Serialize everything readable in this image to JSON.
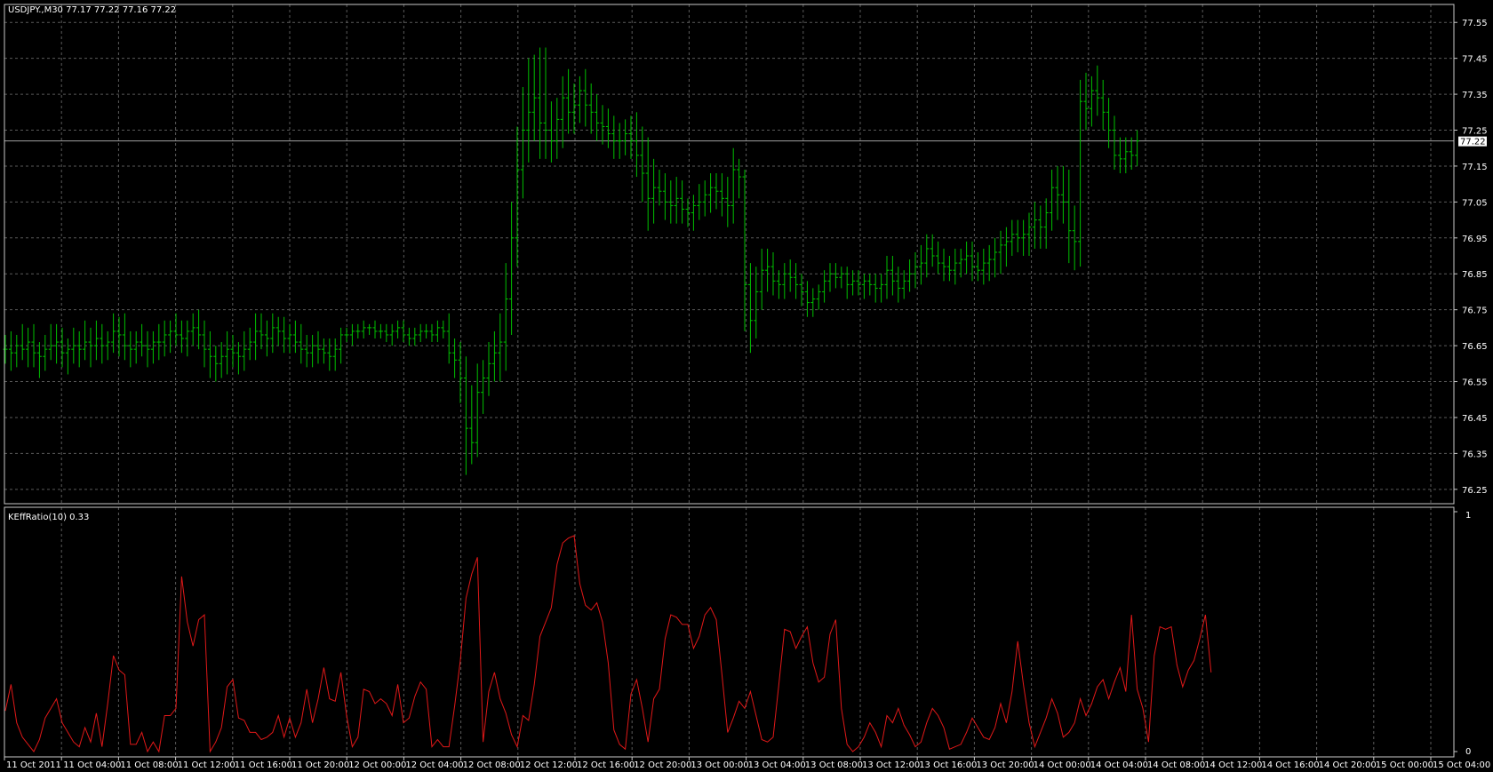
{
  "colors": {
    "background": "#000000",
    "grid": "#5a5a5a",
    "frame": "#c8c8c8",
    "candles": "#00c000",
    "indicator": "#e01818",
    "axis_text": "#ffffff",
    "price_line": "#a0a0a0"
  },
  "price_panel": {
    "title": "USDJPY.,M30  77.17 77.22 77.16 77.22",
    "current_price": "77.22"
  },
  "indicator_panel": {
    "title": "KEffRatio(10) 0.33",
    "top_label": "1",
    "bottom_label": "0"
  },
  "chart_data": [
    {
      "type": "ohlc",
      "title": "USDJPY.,M30  77.17 77.22 77.16 77.22",
      "ylim": [
        76.21,
        77.6
      ],
      "y_ticks": [
        "77.55",
        "77.45",
        "77.35",
        "77.25",
        "77.15",
        "77.05",
        "76.95",
        "76.85",
        "76.75",
        "76.65",
        "76.55",
        "76.45",
        "76.35",
        "76.25"
      ],
      "x_ticks": [
        "11 Oct 2011",
        "11 Oct 04:00",
        "11 Oct 08:00",
        "11 Oct 12:00",
        "11 Oct 16:00",
        "11 Oct 20:00",
        "12 Oct 00:00",
        "12 Oct 04:00",
        "12 Oct 08:00",
        "12 Oct 12:00",
        "12 Oct 16:00",
        "12 Oct 20:00",
        "13 Oct 00:00",
        "13 Oct 04:00",
        "13 Oct 08:00",
        "13 Oct 12:00",
        "13 Oct 16:00",
        "13 Oct 20:00",
        "14 Oct 00:00",
        "14 Oct 04:00",
        "14 Oct 08:00",
        "14 Oct 12:00",
        "14 Oct 16:00",
        "14 Oct 20:00",
        "15 Oct 00:00",
        "15 Oct 04:00"
      ],
      "current_price": 77.22,
      "close": [
        76.64,
        76.63,
        76.65,
        76.64,
        76.66,
        76.63,
        76.62,
        76.64,
        76.65,
        76.66,
        76.63,
        76.64,
        76.65,
        76.64,
        76.66,
        76.65,
        76.67,
        76.65,
        76.66,
        76.69,
        76.68,
        76.65,
        76.64,
        76.66,
        76.65,
        76.64,
        76.66,
        76.66,
        76.68,
        76.69,
        76.68,
        76.67,
        76.69,
        76.7,
        76.68,
        76.64,
        76.62,
        76.6,
        76.62,
        76.64,
        76.63,
        76.62,
        76.64,
        76.66,
        76.69,
        76.68,
        76.67,
        76.7,
        76.69,
        76.67,
        76.68,
        76.66,
        76.64,
        76.63,
        76.65,
        76.64,
        76.63,
        76.62,
        76.64,
        76.68,
        76.68,
        76.69,
        76.69,
        76.7,
        76.7,
        76.69,
        76.69,
        76.68,
        76.69,
        76.7,
        76.68,
        76.67,
        76.68,
        76.69,
        76.69,
        76.68,
        76.7,
        76.69,
        76.63,
        76.61,
        76.56,
        76.42,
        76.38,
        76.52,
        76.56,
        76.6,
        76.63,
        76.66,
        76.78,
        76.95,
        77.14,
        77.25,
        77.3,
        77.34,
        77.27,
        77.25,
        77.22,
        77.28,
        77.34,
        77.3,
        77.32,
        77.36,
        77.32,
        77.3,
        77.27,
        77.26,
        77.24,
        77.22,
        77.22,
        77.24,
        77.22,
        77.18,
        77.13,
        77.06,
        77.09,
        77.08,
        77.05,
        77.04,
        77.06,
        77.03,
        77.02,
        77.04,
        77.05,
        77.07,
        77.09,
        77.08,
        77.06,
        77.04,
        77.14,
        77.12,
        76.82,
        76.72,
        76.8,
        76.86,
        76.87,
        76.83,
        76.82,
        76.85,
        76.84,
        76.82,
        76.8,
        76.77,
        76.78,
        76.8,
        76.83,
        76.85,
        76.84,
        76.85,
        76.82,
        76.83,
        76.82,
        76.83,
        76.82,
        76.81,
        76.82,
        76.86,
        76.83,
        76.81,
        76.83,
        76.85,
        76.87,
        76.88,
        76.92,
        76.9,
        76.88,
        76.87,
        76.86,
        76.88,
        76.89,
        76.9,
        76.87,
        76.86,
        76.88,
        76.89,
        76.91,
        76.93,
        76.94,
        76.96,
        76.95,
        76.96,
        76.98,
        77.0,
        76.98,
        77.02,
        77.09,
        77.07,
        77.05,
        76.97,
        76.94,
        77.33,
        77.31,
        77.36,
        77.34,
        77.3,
        77.25,
        77.18,
        77.17,
        77.19,
        77.18,
        77.22
      ],
      "high_offset": [
        0.04,
        0.05,
        0.03,
        0.06,
        0.04,
        0.05,
        0.03,
        0.04,
        0.06,
        0.05,
        0.04,
        0.03,
        0.05,
        0.04,
        0.06,
        0.04,
        0.05,
        0.04,
        0.03,
        0.05,
        0.04,
        0.06,
        0.04,
        0.03,
        0.05,
        0.04,
        0.03,
        0.05,
        0.04,
        0.03,
        0.05,
        0.04,
        0.03,
        0.04,
        0.05,
        0.04,
        0.05,
        0.03,
        0.04,
        0.05,
        0.04,
        0.03,
        0.05,
        0.04,
        0.05,
        0.05,
        0.04,
        0.04,
        0.03,
        0.04,
        0.03,
        0.04,
        0.05,
        0.04,
        0.03,
        0.04,
        0.03,
        0.04,
        0.03,
        0.02,
        0.02,
        0.02,
        0.02,
        0.02,
        0.01,
        0.02,
        0.02,
        0.02,
        0.02,
        0.02,
        0.02,
        0.02,
        0.02,
        0.02,
        0.02,
        0.02,
        0.02,
        0.02,
        0.05,
        0.04,
        0.05,
        0.06,
        0.12,
        0.08,
        0.05,
        0.06,
        0.06,
        0.08,
        0.1,
        0.1,
        0.12,
        0.12,
        0.15,
        0.12,
        0.14,
        0.21,
        0.08,
        0.06,
        0.06,
        0.08,
        0.06,
        0.04,
        0.06,
        0.06,
        0.05,
        0.05,
        0.05,
        0.05,
        0.05,
        0.04,
        0.05,
        0.08,
        0.08,
        0.1,
        0.08,
        0.05,
        0.05,
        0.06,
        0.06,
        0.05,
        0.03,
        0.03,
        0.05,
        0.04,
        0.04,
        0.04,
        0.05,
        0.06,
        0.06,
        0.03,
        0.02,
        0.06,
        0.07,
        0.06,
        0.05,
        0.04,
        0.03,
        0.03,
        0.04,
        0.04,
        0.03,
        0.03,
        0.03,
        0.02,
        0.03,
        0.03,
        0.03,
        0.02,
        0.02,
        0.03,
        0.03,
        0.02,
        0.02,
        0.03,
        0.03,
        0.04,
        0.04,
        0.04,
        0.03,
        0.04,
        0.04,
        0.05,
        0.04,
        0.04,
        0.04,
        0.04,
        0.03,
        0.04,
        0.03,
        0.04,
        0.04,
        0.04,
        0.04,
        0.04,
        0.04,
        0.04,
        0.04,
        0.04,
        0.04,
        0.04,
        0.04,
        0.05,
        0.04,
        0.04,
        0.05,
        0.06,
        0.08,
        0.09,
        0.07,
        0.06,
        0.08,
        0.04,
        0.07,
        0.05,
        0.04,
        0.04,
        0.05,
        0.04,
        0.04,
        0.03,
        0.03,
        0.04
      ],
      "low_offset": [
        0.04,
        0.05,
        0.04,
        0.03,
        0.05,
        0.04,
        0.06,
        0.04,
        0.03,
        0.05,
        0.04,
        0.06,
        0.04,
        0.05,
        0.03,
        0.06,
        0.04,
        0.05,
        0.04,
        0.03,
        0.06,
        0.04,
        0.05,
        0.04,
        0.03,
        0.05,
        0.04,
        0.05,
        0.04,
        0.05,
        0.03,
        0.04,
        0.05,
        0.04,
        0.04,
        0.05,
        0.06,
        0.05,
        0.04,
        0.05,
        0.04,
        0.05,
        0.04,
        0.03,
        0.05,
        0.04,
        0.05,
        0.04,
        0.04,
        0.04,
        0.04,
        0.03,
        0.04,
        0.04,
        0.04,
        0.04,
        0.03,
        0.04,
        0.04,
        0.04,
        0.02,
        0.03,
        0.02,
        0.02,
        0.02,
        0.02,
        0.02,
        0.02,
        0.03,
        0.02,
        0.02,
        0.02,
        0.02,
        0.02,
        0.02,
        0.02,
        0.02,
        0.02,
        0.03,
        0.05,
        0.07,
        0.13,
        0.06,
        0.04,
        0.06,
        0.05,
        0.05,
        0.08,
        0.08,
        0.1,
        0.08,
        0.08,
        0.09,
        0.08,
        0.1,
        0.08,
        0.06,
        0.05,
        0.08,
        0.06,
        0.06,
        0.05,
        0.06,
        0.06,
        0.05,
        0.05,
        0.04,
        0.05,
        0.05,
        0.04,
        0.05,
        0.06,
        0.08,
        0.09,
        0.07,
        0.04,
        0.05,
        0.05,
        0.05,
        0.04,
        0.04,
        0.05,
        0.04,
        0.04,
        0.05,
        0.05,
        0.05,
        0.06,
        0.05,
        0.06,
        0.13,
        0.09,
        0.05,
        0.05,
        0.06,
        0.04,
        0.04,
        0.04,
        0.04,
        0.04,
        0.04,
        0.04,
        0.04,
        0.03,
        0.03,
        0.03,
        0.03,
        0.03,
        0.04,
        0.03,
        0.03,
        0.04,
        0.03,
        0.04,
        0.04,
        0.04,
        0.04,
        0.04,
        0.03,
        0.03,
        0.04,
        0.05,
        0.04,
        0.03,
        0.03,
        0.04,
        0.03,
        0.04,
        0.04,
        0.04,
        0.04,
        0.03,
        0.04,
        0.05,
        0.05,
        0.06,
        0.06,
        0.04,
        0.04,
        0.05,
        0.06,
        0.06,
        0.06,
        0.06,
        0.05,
        0.07,
        0.06,
        0.09,
        0.08,
        0.07,
        0.06,
        0.05,
        0.05,
        0.05,
        0.05,
        0.04,
        0.04,
        0.04,
        0.04,
        0.03
      ]
    },
    {
      "type": "line",
      "title": "KEffRatio(10) 0.33",
      "ylim": [
        0,
        1
      ],
      "y_ticks": [
        "1",
        "0"
      ],
      "series": [
        {
          "name": "KEffRatio(10)",
          "values": [
            0.17,
            0.28,
            0.12,
            0.06,
            0.03,
            0.0,
            0.05,
            0.14,
            0.18,
            0.22,
            0.12,
            0.08,
            0.04,
            0.02,
            0.1,
            0.04,
            0.16,
            0.02,
            0.2,
            0.4,
            0.34,
            0.32,
            0.03,
            0.03,
            0.08,
            0.0,
            0.04,
            0.0,
            0.15,
            0.15,
            0.18,
            0.73,
            0.54,
            0.44,
            0.55,
            0.57,
            0.0,
            0.04,
            0.1,
            0.27,
            0.3,
            0.14,
            0.13,
            0.08,
            0.08,
            0.05,
            0.06,
            0.08,
            0.15,
            0.06,
            0.14,
            0.06,
            0.12,
            0.26,
            0.12,
            0.22,
            0.35,
            0.22,
            0.21,
            0.33,
            0.15,
            0.02,
            0.06,
            0.26,
            0.25,
            0.2,
            0.22,
            0.2,
            0.15,
            0.28,
            0.12,
            0.14,
            0.23,
            0.29,
            0.26,
            0.02,
            0.05,
            0.02,
            0.02,
            0.19,
            0.38,
            0.64,
            0.74,
            0.81,
            0.04,
            0.25,
            0.33,
            0.22,
            0.16,
            0.07,
            0.02,
            0.15,
            0.13,
            0.28,
            0.48,
            0.54,
            0.6,
            0.78,
            0.87,
            0.89,
            0.9,
            0.7,
            0.61,
            0.59,
            0.62,
            0.54,
            0.37,
            0.09,
            0.03,
            0.01,
            0.24,
            0.3,
            0.18,
            0.04,
            0.22,
            0.26,
            0.47,
            0.57,
            0.56,
            0.53,
            0.53,
            0.43,
            0.48,
            0.57,
            0.6,
            0.55,
            0.32,
            0.08,
            0.14,
            0.21,
            0.18,
            0.25,
            0.15,
            0.05,
            0.04,
            0.06,
            0.28,
            0.51,
            0.5,
            0.43,
            0.48,
            0.52,
            0.37,
            0.29,
            0.31,
            0.49,
            0.55,
            0.18,
            0.03,
            0.0,
            0.02,
            0.06,
            0.12,
            0.08,
            0.02,
            0.15,
            0.12,
            0.18,
            0.11,
            0.07,
            0.02,
            0.04,
            0.12,
            0.18,
            0.15,
            0.1,
            0.01,
            0.02,
            0.03,
            0.08,
            0.14,
            0.1,
            0.06,
            0.05,
            0.1,
            0.2,
            0.12,
            0.25,
            0.46,
            0.28,
            0.12,
            0.02,
            0.08,
            0.14,
            0.22,
            0.16,
            0.06,
            0.08,
            0.12,
            0.22,
            0.15,
            0.2,
            0.27,
            0.3,
            0.22,
            0.29,
            0.35,
            0.25,
            0.57,
            0.26,
            0.18,
            0.04,
            0.4,
            0.52,
            0.51,
            0.52,
            0.36,
            0.27,
            0.34,
            0.38,
            0.47,
            0.57,
            0.33
          ]
        }
      ]
    }
  ]
}
